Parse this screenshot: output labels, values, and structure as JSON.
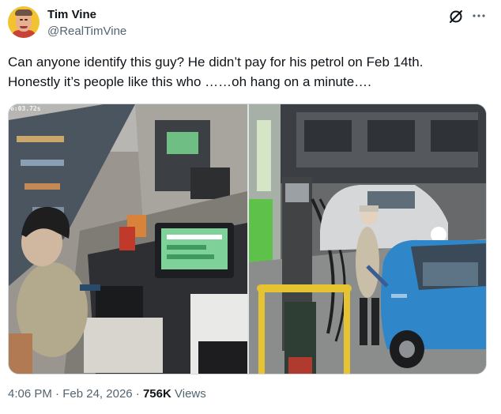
{
  "author": {
    "display_name": "Tim Vine",
    "handle": "@RealTimVine"
  },
  "icons": {
    "grok": "grok-slash-icon",
    "more": "more-options-icon"
  },
  "tweet": {
    "text_line1": "Can anyone identify this guy? He didn’t pay for his petrol on Feb 14th.",
    "text_line2": "Honestly it’s people like this who ……oh hang on a minute…."
  },
  "media": {
    "left_photo_timestamp": "6:03.72s"
  },
  "meta": {
    "time": "4:06 PM",
    "separator": "·",
    "date": "Feb 24, 2026",
    "views_count": "756K",
    "views_label": "Views"
  },
  "colors": {
    "text_primary": "#0f1419",
    "text_secondary": "#536471",
    "border": "#cfd9de",
    "car_blue": "#2f86c8",
    "pump_green": "#5ec24a",
    "pump_yellow": "#e6c330"
  }
}
